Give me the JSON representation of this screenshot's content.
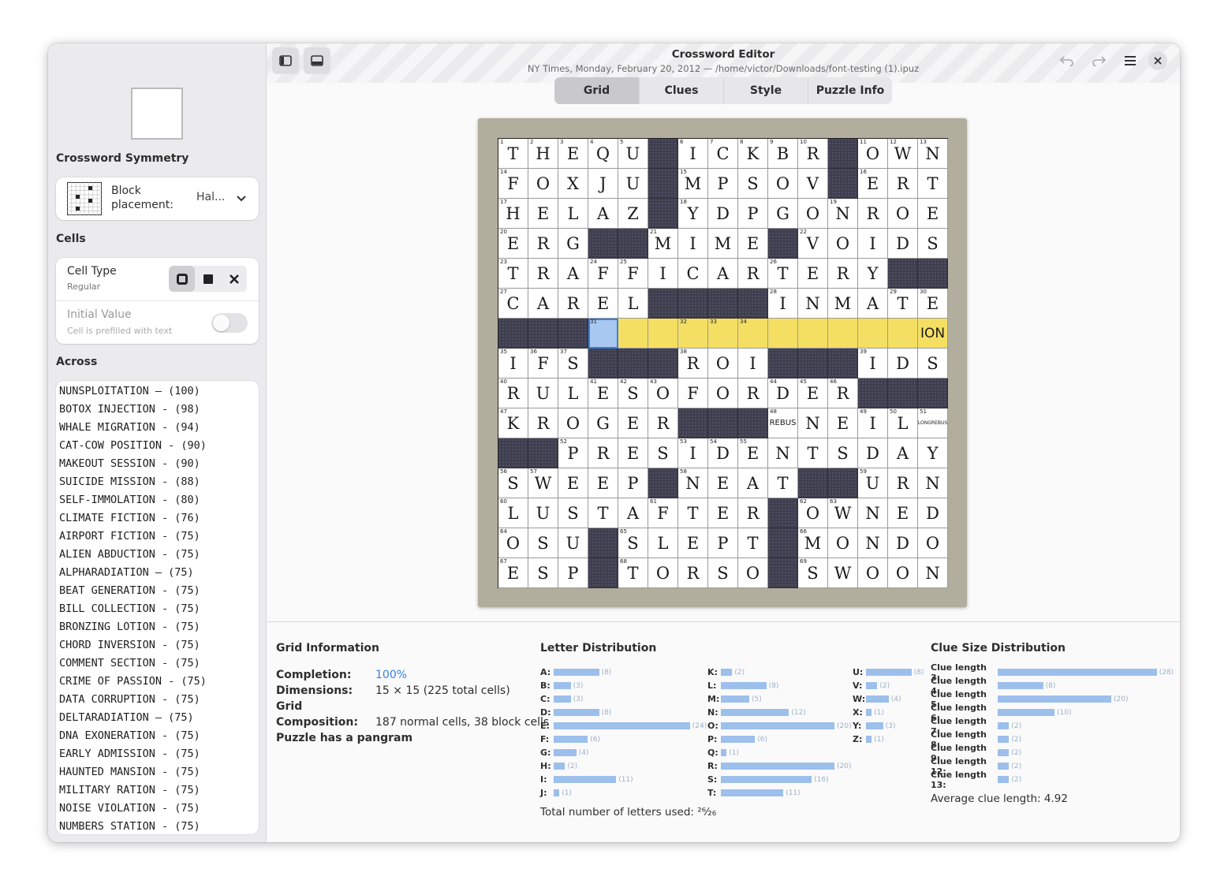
{
  "header": {
    "title": "Crossword Editor",
    "subtitle": "NY Times, Monday, February 20, 2012 — /home/victor/Downloads/font-testing (1).ipuz",
    "tabs": [
      {
        "label": "Grid",
        "active": true
      },
      {
        "label": "Clues",
        "active": false
      },
      {
        "label": "Style",
        "active": false
      },
      {
        "label": "Puzzle Info",
        "active": false
      }
    ],
    "icons": [
      "sidebar-icon",
      "bottom-panel-icon",
      "undo-icon",
      "redo-icon",
      "menu-icon",
      "close-icon"
    ]
  },
  "sidebar": {
    "symmetry_heading": "Crossword Symmetry",
    "block_placement_label": "Block\nplacement:",
    "block_placement_value": "Hal...",
    "cells_heading": "Cells",
    "cell_type_label": "Cell Type",
    "cell_type_value": "Regular",
    "initial_value_label": "Initial Value",
    "initial_value_sub": "Cell is prefilled with text",
    "initial_value_on": false,
    "across_heading": "Across",
    "across_items": [
      "NUNSPLOITATION — (100)",
      "BOTOX INJECTION - (98)",
      "WHALE MIGRATION - (94)",
      "CAT-COW POSITION - (90)",
      "MAKEOUT SESSION - (90)",
      "SUICIDE MISSION - (88)",
      "SELF-IMMOLATION - (80)",
      "CLIMATE FICTION - (76)",
      "AIRPORT FICTION - (75)",
      "ALIEN ABDUCTION - (75)",
      "ALPHARADIATION — (75)",
      "BEAT GENERATION - (75)",
      "BILL COLLECTION - (75)",
      "BRONZING LOTION - (75)",
      "CHORD INVERSION - (75)",
      "COMMENT SECTION - (75)",
      "CRIME OF PASSION - (75)",
      "DATA CORRUPTION - (75)",
      "DELTARADIATION — (75)",
      "DNA EXONERATION - (75)",
      "EARLY ADMISSION - (75)",
      "HAUNTED MANSION - (75)",
      "MILITARY RATION - (75)",
      "NOISE VIOLATION - (75)",
      "NUMBERS STATION - (75)"
    ]
  },
  "grid": {
    "rows": [
      "THEQU#ICKBR#OWN",
      "FOXJU#MPSOV#ERT",
      "HELAZ#YDPGONROE",
      "ERG##MIME#VOIDS",
      "TRAFFICARTERY##",
      "CAREL####INMATE",
      "###............",
      "IFS###ROI###IDS",
      "RULESOFORDER###",
      "KROGER###.NEIL.",
      "##PRESIDENTSDAY",
      "SWEEP#NEAT##URN",
      "LUSTAFTER#OWNED",
      "OSU#SLEPT#MONDO",
      "ESP#TORSO#SWOON"
    ],
    "numbers": [
      [
        0,
        0,
        1
      ],
      [
        0,
        1,
        2
      ],
      [
        0,
        2,
        3
      ],
      [
        0,
        3,
        4
      ],
      [
        0,
        4,
        5
      ],
      [
        0,
        6,
        6
      ],
      [
        0,
        7,
        7
      ],
      [
        0,
        8,
        8
      ],
      [
        0,
        9,
        9
      ],
      [
        0,
        10,
        10
      ],
      [
        0,
        12,
        11
      ],
      [
        0,
        13,
        12
      ],
      [
        0,
        14,
        13
      ],
      [
        1,
        0,
        14
      ],
      [
        1,
        6,
        15
      ],
      [
        1,
        12,
        16
      ],
      [
        2,
        0,
        17
      ],
      [
        2,
        6,
        18
      ],
      [
        2,
        11,
        19
      ],
      [
        3,
        0,
        20
      ],
      [
        3,
        5,
        21
      ],
      [
        3,
        10,
        22
      ],
      [
        4,
        0,
        23
      ],
      [
        4,
        3,
        24
      ],
      [
        4,
        4,
        25
      ],
      [
        4,
        9,
        26
      ],
      [
        5,
        0,
        27
      ],
      [
        5,
        9,
        28
      ],
      [
        5,
        13,
        29
      ],
      [
        5,
        14,
        30
      ],
      [
        6,
        3,
        31
      ],
      [
        6,
        6,
        32
      ],
      [
        6,
        7,
        33
      ],
      [
        6,
        8,
        34
      ],
      [
        7,
        0,
        35
      ],
      [
        7,
        1,
        36
      ],
      [
        7,
        2,
        37
      ],
      [
        7,
        6,
        38
      ],
      [
        7,
        12,
        39
      ],
      [
        8,
        0,
        40
      ],
      [
        8,
        3,
        41
      ],
      [
        8,
        4,
        42
      ],
      [
        8,
        5,
        43
      ],
      [
        8,
        9,
        44
      ],
      [
        8,
        10,
        45
      ],
      [
        8,
        11,
        46
      ],
      [
        9,
        0,
        47
      ],
      [
        9,
        9,
        48
      ],
      [
        9,
        12,
        49
      ],
      [
        9,
        13,
        50
      ],
      [
        9,
        14,
        51
      ],
      [
        10,
        2,
        52
      ],
      [
        10,
        6,
        53
      ],
      [
        10,
        7,
        54
      ],
      [
        10,
        8,
        55
      ],
      [
        11,
        0,
        56
      ],
      [
        11,
        1,
        57
      ],
      [
        11,
        6,
        58
      ],
      [
        11,
        12,
        59
      ],
      [
        12,
        0,
        60
      ],
      [
        12,
        5,
        61
      ],
      [
        12,
        10,
        62
      ],
      [
        12,
        11,
        63
      ],
      [
        13,
        0,
        64
      ],
      [
        13,
        4,
        65
      ],
      [
        13,
        10,
        66
      ],
      [
        14,
        0,
        67
      ],
      [
        14,
        4,
        68
      ],
      [
        14,
        10,
        69
      ]
    ],
    "special_cells": {
      "9,9": "REBUS",
      "9,14": "LONGREBUS",
      "6,14": "ION"
    },
    "selected_cell": [
      6,
      3
    ],
    "highlight_row": 6,
    "highlight_from_col": 4
  },
  "info": {
    "grid_heading": "Grid Information",
    "completion_label": "Completion:",
    "completion_value": "100%",
    "dimensions_label": "Dimensions:",
    "dimensions_value": "15 × 15 (225 total cells)",
    "composition_label": "Grid Composition:",
    "composition_value": "187 normal cells, 38 block cells",
    "pangram": "Puzzle has a pangram",
    "letter_heading": "Letter Distribution",
    "letters": [
      {
        "l": "A:",
        "v": 8
      },
      {
        "l": "B:",
        "v": 3
      },
      {
        "l": "C:",
        "v": 3
      },
      {
        "l": "D:",
        "v": 8
      },
      {
        "l": "E:",
        "v": 24
      },
      {
        "l": "F:",
        "v": 6
      },
      {
        "l": "G:",
        "v": 4
      },
      {
        "l": "H:",
        "v": 2
      },
      {
        "l": "I:",
        "v": 11
      },
      {
        "l": "J:",
        "v": 1
      },
      {
        "l": "K:",
        "v": 2
      },
      {
        "l": "L:",
        "v": 8
      },
      {
        "l": "M:",
        "v": 5
      },
      {
        "l": "N:",
        "v": 12
      },
      {
        "l": "O:",
        "v": 20
      },
      {
        "l": "P:",
        "v": 6
      },
      {
        "l": "Q:",
        "v": 1
      },
      {
        "l": "R:",
        "v": 20
      },
      {
        "l": "S:",
        "v": 16
      },
      {
        "l": "T:",
        "v": 11
      },
      {
        "l": "U:",
        "v": 8
      },
      {
        "l": "V:",
        "v": 2
      },
      {
        "l": "W:",
        "v": 4
      },
      {
        "l": "X:",
        "v": 1
      },
      {
        "l": "Y:",
        "v": 3
      },
      {
        "l": "Z:",
        "v": 1
      }
    ],
    "letters_total": "Total number of letters used: ²⁶⁄₂₆",
    "clue_heading": "Clue Size Distribution",
    "clue_sizes": [
      {
        "l": "Clue length 3:",
        "v": 28
      },
      {
        "l": "Clue length 4:",
        "v": 8
      },
      {
        "l": "Clue length 5:",
        "v": 20
      },
      {
        "l": "Clue length 6:",
        "v": 10
      },
      {
        "l": "Clue length 7:",
        "v": 2
      },
      {
        "l": "Clue length 8:",
        "v": 2
      },
      {
        "l": "Clue length 9:",
        "v": 2
      },
      {
        "l": "Clue length 12:",
        "v": 2
      },
      {
        "l": "Clue length 13:",
        "v": 2
      }
    ],
    "average": "Average clue length: 4.92"
  },
  "colors": {
    "accent": "#3584e4",
    "block": "#3e3e4e",
    "highlight": "#f5df63",
    "selected": "#a8c8f0",
    "bar": "#9cbfec"
  }
}
